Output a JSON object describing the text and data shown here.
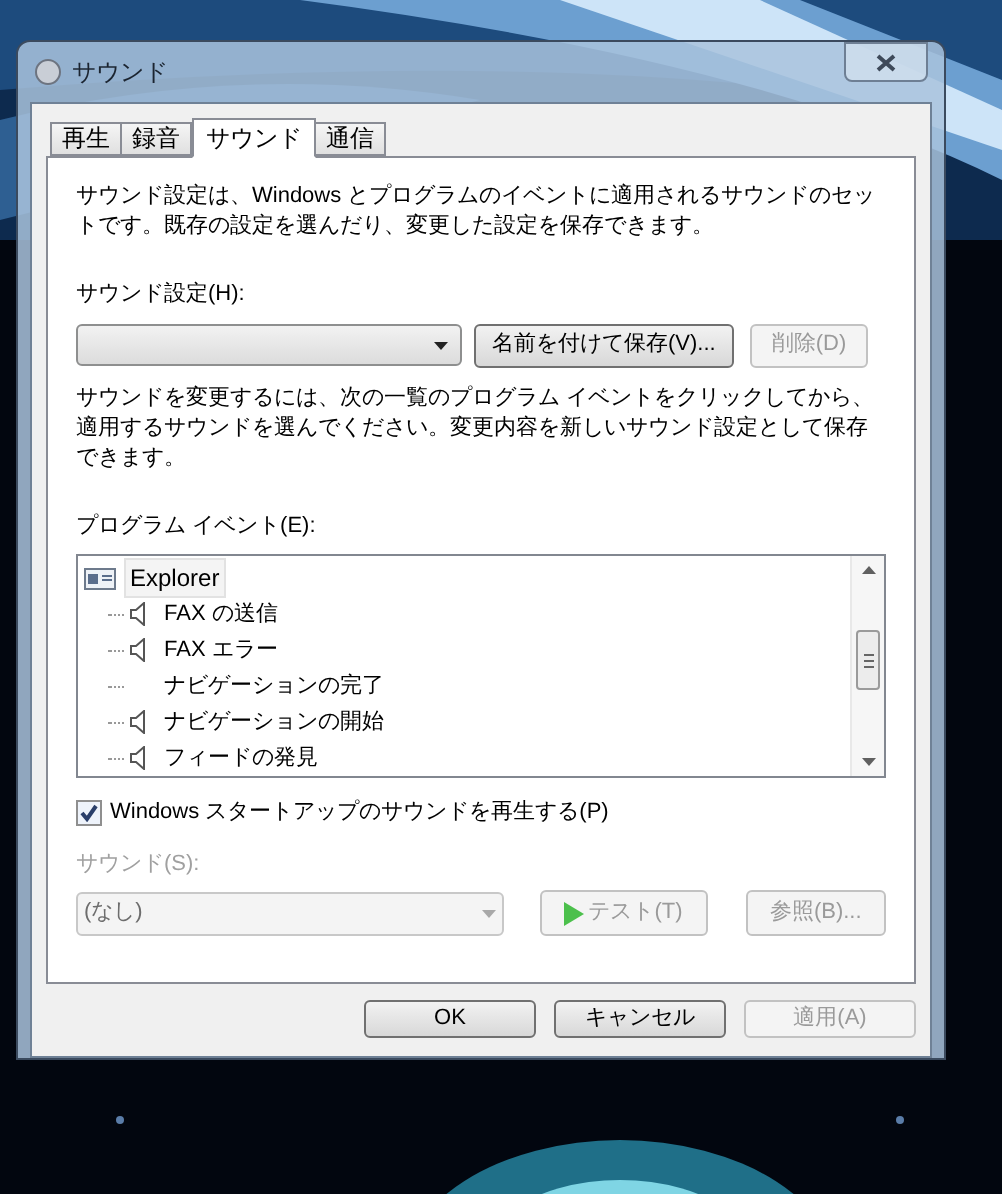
{
  "window": {
    "title": "サウンド"
  },
  "tabs": [
    {
      "label": "再生",
      "selected": false
    },
    {
      "label": "録音",
      "selected": false
    },
    {
      "label": "サウンド",
      "selected": true
    },
    {
      "label": "通信",
      "selected": false
    }
  ],
  "description": "サウンド設定は、Windows とプログラムのイベントに適用されるサウンドのセットです。既存の設定を選んだり、変更した設定を保存できます。",
  "scheme": {
    "label": "サウンド設定(H):",
    "save_as_button": {
      "label": "名前を付けて保存(V)...",
      "disabled": false
    },
    "delete_button": {
      "label": "削除(D)",
      "disabled": true
    }
  },
  "instructions": "サウンドを変更するには、次の一覧のプログラム イベントをクリックしてから、適用するサウンドを選んでください。変更内容を新しいサウンド設定として保存できます。",
  "program_events": {
    "label": "プログラム イベント(E):",
    "items": [
      {
        "label": "Explorer",
        "selected": true,
        "children": [
          {
            "label": "FAX の送信",
            "has_sound": true,
            "selected": false
          },
          {
            "label": "FAX エラー",
            "has_sound": true,
            "selected": false
          },
          {
            "label": "ナビゲーションの完了",
            "has_sound": false,
            "selected": false
          },
          {
            "label": "ナビゲーションの開始",
            "has_sound": true,
            "selected": false
          },
          {
            "label": "フィードの発見",
            "has_sound": true,
            "selected": false
          }
        ]
      }
    ]
  },
  "startup_sound": {
    "label": "Windows スタートアップのサウンドを再生する(P)",
    "checked": true
  },
  "sound": {
    "label": "サウンド(S):",
    "value": "(なし)",
    "disabled": true,
    "test_button": {
      "label": "テスト(T)",
      "disabled": true
    },
    "browse_button": {
      "label": "参照(B)...",
      "disabled": true
    }
  },
  "buttons": [
    {
      "label": "OK",
      "disabled": false
    },
    {
      "label": "キャンセル",
      "disabled": false
    },
    {
      "label": "適用(A)",
      "disabled": true
    }
  ]
}
